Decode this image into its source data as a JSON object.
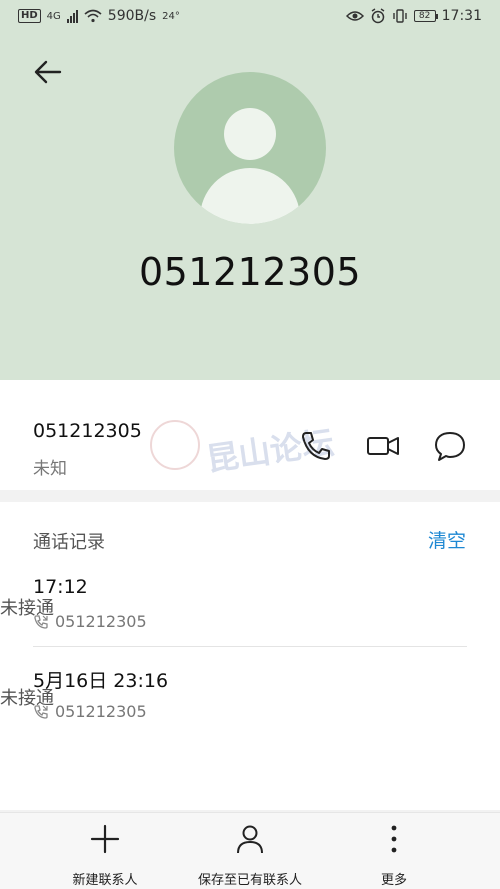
{
  "status_bar": {
    "hd": "HD",
    "network": "4G",
    "speed": "590B/s",
    "temp": "24°",
    "battery": "82",
    "time": "17:31"
  },
  "header": {
    "title_number": "051212305"
  },
  "contact": {
    "number": "051212305",
    "location": "未知",
    "watermark_text": "昆山论坛"
  },
  "call_log": {
    "header": "通话记录",
    "clear_label": "清空",
    "entries": [
      {
        "time": "17:12",
        "number": "051212305",
        "status": "未接通"
      },
      {
        "time": "5月16日  23:16",
        "number": "051212305",
        "status": "未接通"
      }
    ]
  },
  "bottom_bar": {
    "new_contact": "新建联系人",
    "save_existing": "保存至已有联系人",
    "more": "更多"
  },
  "colors": {
    "header_bg": "#d6e4d5",
    "avatar_bg": "#aecbad",
    "accent": "#1e88d3"
  }
}
